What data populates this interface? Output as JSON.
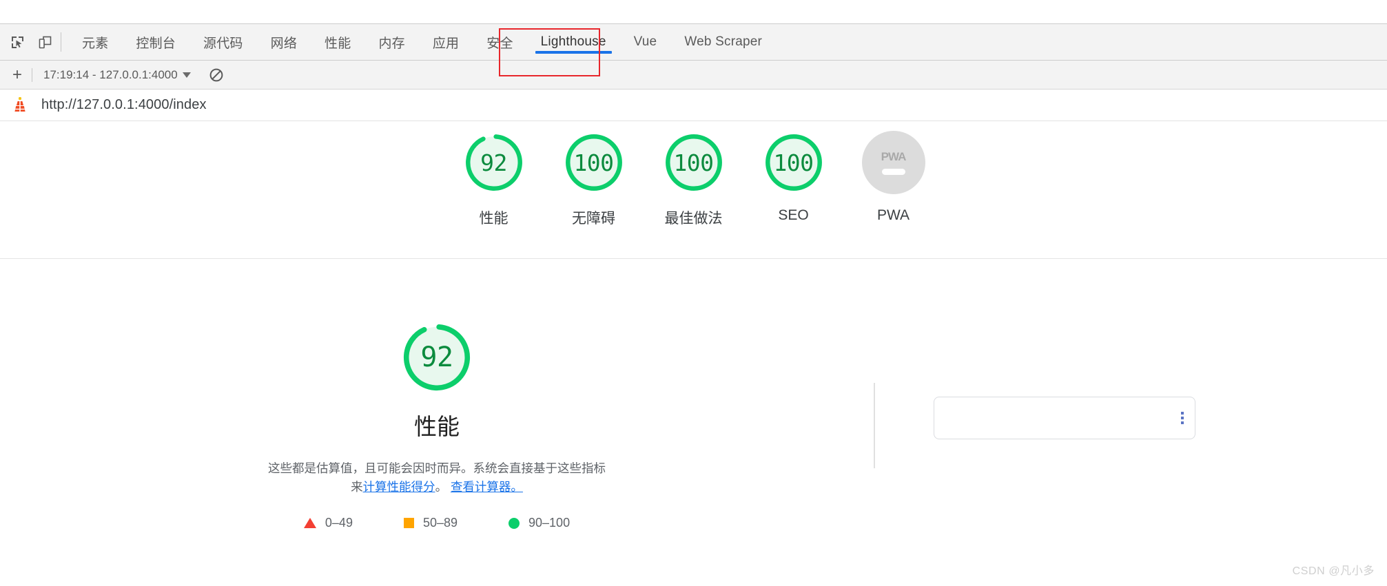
{
  "devtools": {
    "icons": [
      {
        "name": "inspect-element-icon",
        "label": "Inspect element"
      },
      {
        "name": "device-toolbar-icon",
        "label": "Toggle device toolbar"
      }
    ],
    "tabs": [
      {
        "label": "元素",
        "active": false,
        "cjk": true
      },
      {
        "label": "控制台",
        "active": false,
        "cjk": true
      },
      {
        "label": "源代码",
        "active": false,
        "cjk": true
      },
      {
        "label": "网络",
        "active": false,
        "cjk": true
      },
      {
        "label": "性能",
        "active": false,
        "cjk": true
      },
      {
        "label": "内存",
        "active": false,
        "cjk": true
      },
      {
        "label": "应用",
        "active": false,
        "cjk": true
      },
      {
        "label": "安全",
        "active": false,
        "cjk": true
      },
      {
        "label": "Lighthouse",
        "active": true,
        "cjk": false
      },
      {
        "label": "Vue",
        "active": false,
        "cjk": false
      },
      {
        "label": "Web Scraper",
        "active": false,
        "cjk": false
      }
    ]
  },
  "lighthouse_toolbar": {
    "add_label": "+",
    "run_selector": "17:19:14 - 127.0.0.1:4000",
    "clear_icon": "clear-prohibited-icon"
  },
  "url_bar": {
    "logo_icon": "lighthouse-logo-icon",
    "url": "http://127.0.0.1:4000/index"
  },
  "scores": [
    {
      "value": "92",
      "label": "性能",
      "percent": 92,
      "type": "gauge",
      "color": "#0cce6b"
    },
    {
      "value": "100",
      "label": "无障碍",
      "percent": 100,
      "type": "gauge",
      "color": "#0cce6b"
    },
    {
      "value": "100",
      "label": "最佳做法",
      "percent": 100,
      "type": "gauge",
      "color": "#0cce6b"
    },
    {
      "value": "100",
      "label": "SEO",
      "percent": 100,
      "type": "gauge",
      "color": "#0cce6b"
    },
    {
      "value": "PWA",
      "label": "PWA",
      "percent": 0,
      "type": "badge",
      "color": "#dcdcdc"
    }
  ],
  "performance": {
    "score": "92",
    "percent": 92,
    "title": "性能",
    "description_prefix": "这些都是估算值，且可能会因时而异。系统会直接基于这些指标来",
    "link1": "计算性能得分",
    "separator1": "。 ",
    "link2": "查看计算器。",
    "legend": [
      {
        "shape": "triangle",
        "range": "0–49",
        "color": "#f33f33"
      },
      {
        "shape": "square",
        "range": "50–89",
        "color": "#ffa400"
      },
      {
        "shape": "circle",
        "range": "90–100",
        "color": "#0cce6b"
      }
    ]
  },
  "right_panel": {
    "menu_icon": "kebab-menu-icon",
    "content": ""
  },
  "watermark": "CSDN @凡小多",
  "colors": {
    "accent_blue": "#1a73e8",
    "pass_green": "#0cce6b",
    "average_orange": "#ffa400",
    "fail_red": "#f33f33",
    "annotation_red": "#e8262b",
    "score_text_green": "#0c8b3e",
    "gauge_fill_green": "#e8f8ee"
  }
}
